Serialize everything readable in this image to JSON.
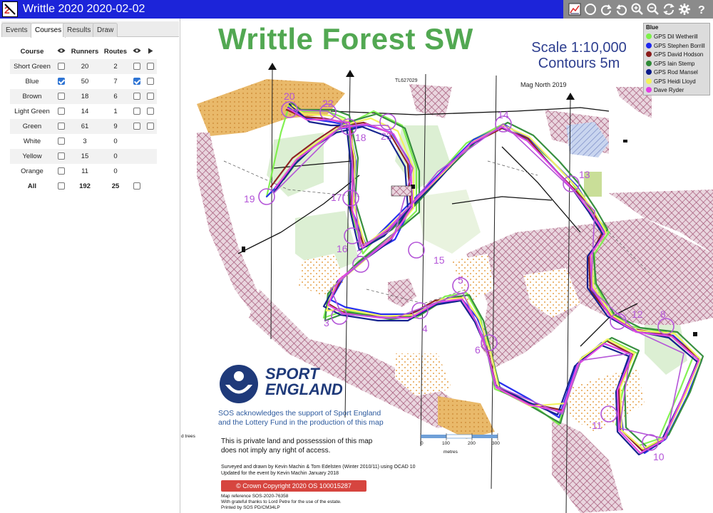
{
  "app": {
    "title": "Writtle 2020 2020-02-02",
    "logo_icon": "rg2-logo-icon"
  },
  "toolbar": {
    "icons": [
      "colour-chart-icon",
      "circle-icon",
      "rotate-right-icon",
      "rotate-left-icon",
      "zoom-in-icon",
      "zoom-out-icon",
      "reset-icon",
      "settings-gear-icon",
      "help-icon"
    ]
  },
  "tabs": [
    {
      "label": "Events",
      "active": false
    },
    {
      "label": "Courses",
      "active": true
    },
    {
      "label": "Results",
      "active": false
    },
    {
      "label": "Draw",
      "active": false
    }
  ],
  "courses_table": {
    "headers": {
      "course": "Course",
      "runners": "Runners",
      "routes": "Routes"
    },
    "rows": [
      {
        "course": "Short Green",
        "show": false,
        "runners": "20",
        "routes": "2",
        "show_routes": false,
        "replay": false,
        "has_route_controls": true
      },
      {
        "course": "Blue",
        "show": true,
        "runners": "50",
        "routes": "7",
        "show_routes": true,
        "replay": false,
        "has_route_controls": true
      },
      {
        "course": "Brown",
        "show": false,
        "runners": "18",
        "routes": "6",
        "show_routes": false,
        "replay": false,
        "has_route_controls": true
      },
      {
        "course": "Light Green",
        "show": false,
        "runners": "14",
        "routes": "1",
        "show_routes": false,
        "replay": false,
        "has_route_controls": true
      },
      {
        "course": "Green",
        "show": false,
        "runners": "61",
        "routes": "9",
        "show_routes": false,
        "replay": false,
        "has_route_controls": true
      },
      {
        "course": "White",
        "show": false,
        "runners": "3",
        "routes": "0",
        "show_routes": false,
        "replay": false,
        "has_route_controls": false
      },
      {
        "course": "Yellow",
        "show": false,
        "runners": "15",
        "routes": "0",
        "show_routes": false,
        "replay": false,
        "has_route_controls": false
      },
      {
        "course": "Orange",
        "show": false,
        "runners": "11",
        "routes": "0",
        "show_routes": false,
        "replay": false,
        "has_route_controls": false
      }
    ],
    "total": {
      "course": "All",
      "runners": "192",
      "routes": "25"
    }
  },
  "map": {
    "title": "Writtle Forest SW",
    "scale_line1": "Scale 1:10,000",
    "scale_line2": "Contours 5m",
    "mag_north": "Mag North 2019",
    "grid_ref": "TL627029",
    "sport_line1": "SPORT",
    "sport_line2": "ENGLAND",
    "sos_line1": "SOS acknowledges the support of Sport England",
    "sos_line2": "and the Lottery Fund in the production of this map",
    "private_line1": "This is private land and possesssion of this map",
    "private_line2": "does not imply any right of access.",
    "surveyed_line1": "Surveyed and drawn by Kevin Machin & Tom Edelsten (Winter 2010/11) using OCAD 10",
    "surveyed_line2": "Updated for the event by Kevin Machin January 2018",
    "copyright": "© Crown Copyright 2020 OS 100015287",
    "mapref_line1": "Map reference  SOS-2020-76358",
    "mapref_line2": "With grateful thanks to Lord Petre for the use of the estate.",
    "mapref_line3": "Printed by SOS PD/CM34LP",
    "trees_label": "d trees",
    "scalebar_ticks": [
      "0",
      "100",
      "200",
      "300"
    ],
    "scalebar_unit": "metres",
    "control_numbers": [
      "20",
      "22",
      "18",
      "23",
      "14",
      "19",
      "17",
      "13",
      "16",
      "2",
      "15",
      "5",
      "3",
      "4",
      "6",
      "12",
      "8",
      "11",
      "10"
    ],
    "colors": {
      "title_green": "#52a852",
      "control_purple": "#b455d8",
      "olive": "#e9c78c",
      "hatch": "#b0657f",
      "field": "#f2e7c9"
    }
  },
  "legend": {
    "title": "Blue",
    "entries": [
      {
        "name": "GPS Dil Wetherill",
        "color": "#7df04a"
      },
      {
        "name": "GPS Stephen Borrill",
        "color": "#1d26ee"
      },
      {
        "name": "GPS David Hodson",
        "color": "#8a1a1a"
      },
      {
        "name": "GPS Iain Stemp",
        "color": "#2e8a36"
      },
      {
        "name": "GPS Rod Mansel",
        "color": "#0a1a8a"
      },
      {
        "name": "GPS Heidi Lloyd",
        "color": "#f3f35a"
      },
      {
        "name": "Dave Ryder",
        "color": "#e340e3"
      }
    ]
  }
}
